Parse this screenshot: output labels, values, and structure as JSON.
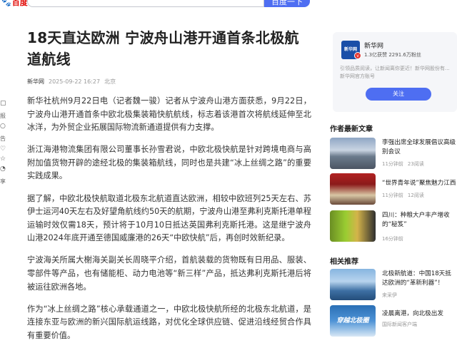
{
  "header": {
    "logo_text": "百度",
    "search_button_label": "百度一下"
  },
  "share_bar": {
    "items": [
      "报",
      "告",
      "享"
    ]
  },
  "article": {
    "title": "18天直达欧洲 宁波舟山港开通首条北极航道航线",
    "source": "新华网",
    "datetime": "2025-09-22 16:27",
    "location": "北京",
    "paragraphs": [
      "新华社杭州9月22日电（记者魏一骏）记者从宁波舟山港方面获悉，9月22日，宁波舟山港开通首条中欧北极集装箱快航航线，标志着该港首次将航线延伸至北冰洋，为外贸企业拓展国际物流新通道提供有力支撑。",
      "浙江海港物流集团有限公司董事长孙雪君说，中欧北极快航是针对跨境电商与高附加值货物开辟的途经北极的集装箱航线，同时也是共建“冰上丝绸之路”的重要实践成果。",
      "据了解，中欧北极快航取道北极东北航道直达欧洲，相较中欧班列25天左右、苏伊士运河40天左右及好望角航线约50天的航期，宁波舟山港至弗利克斯托港单程运输时效仅需18天，预计将于10月10日抵达英国弗利克斯托港。这是继宁波舟山港2024年底开通至德国威廉港的26天“中欧快航”后，再创时效新纪录。",
      "宁波海关所属大榭海关副关长周晓平介绍，首航装载的货物既有日用品、服装、零部件等产品，也有储能柜、动力电池等“新三样”产品，抵达弗利克斯托港后将被运往欧洲各地。",
      "作为“冰上丝绸之路”核心承载通道之一，中欧北极快航所经的北极东北航道，是连接东亚与欧洲的新兴国际航运线路，对优化全球供应链、促进沿线经贸合作具有重要价值。"
    ]
  },
  "author_card": {
    "avatar_text": "新华网",
    "name": "新华网",
    "stats": "1.3亿获赞 2291.6万粉丝",
    "desc_line1": "引领品质阅读，让新闻离你更近！新华网股份有...",
    "desc_line2": "新华网官方账号",
    "follow_label": "关注"
  },
  "author_news": {
    "section_title": "作者最新文章",
    "items": [
      {
        "title": "李强出席全球发展倡议高级别会议",
        "time": "11分钟前",
        "reads": "23阅读"
      },
      {
        "title": "“世界青年说”聚焦魅力江西",
        "time": "11分钟前",
        "reads": "12阅读"
      },
      {
        "title": "四川：种粮大户丰产增收的“秘笈”",
        "time": "16分钟前",
        "reads": ""
      }
    ]
  },
  "related_news": {
    "section_title": "相关推荐",
    "items": [
      {
        "title": "北极新航道：中国18天抵达欧洲的“革新利器”！",
        "source": "来采伊"
      },
      {
        "title": "凌晨离港，向北极出发",
        "source": "国际新闻客户端",
        "thumb_text": "穿越北极圈"
      }
    ]
  },
  "colors": {
    "accent": "#4e6ef2",
    "logo_red": "#e10602"
  }
}
